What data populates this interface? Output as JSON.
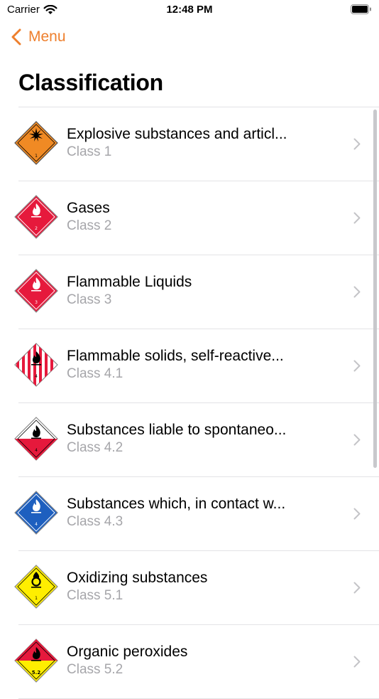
{
  "status_bar": {
    "carrier": "Carrier",
    "time": "12:48 PM"
  },
  "nav": {
    "back_label": "Menu"
  },
  "page_title": "Classification",
  "items": [
    {
      "title": "Explosive substances and articl...",
      "subtitle": "Class 1",
      "icon": "explosive-placard-icon",
      "number": "1"
    },
    {
      "title": "Gases",
      "subtitle": "Class 2",
      "icon": "flammable-gas-placard-icon",
      "number": "2"
    },
    {
      "title": "Flammable Liquids",
      "subtitle": "Class 3",
      "icon": "flammable-liquid-placard-icon",
      "number": "3"
    },
    {
      "title": "Flammable solids, self-reactive...",
      "subtitle": "Class 4.1",
      "icon": "flammable-solid-placard-icon",
      "number": "4"
    },
    {
      "title": "Substances liable to spontaneo...",
      "subtitle": "Class 4.2",
      "icon": "spontaneous-combustion-placard-icon",
      "number": "4"
    },
    {
      "title": "Substances which, in contact w...",
      "subtitle": "Class 4.3",
      "icon": "dangerous-when-wet-placard-icon",
      "number": "4"
    },
    {
      "title": "Oxidizing substances",
      "subtitle": "Class 5.1",
      "icon": "oxidizer-placard-icon",
      "number": "1"
    },
    {
      "title": "Organic peroxides",
      "subtitle": "Class 5.2",
      "icon": "organic-peroxide-placard-icon",
      "number": "5.2"
    }
  ],
  "colors": {
    "accent": "#ee7f2d",
    "explosive_orange": "#f08a24",
    "flammable_red": "#e6193c",
    "water_blue": "#1d5fbf",
    "oxidizer_yellow": "#ffee00",
    "separator": "#e3e3e6",
    "subtitle_gray": "#a6a6aa"
  }
}
